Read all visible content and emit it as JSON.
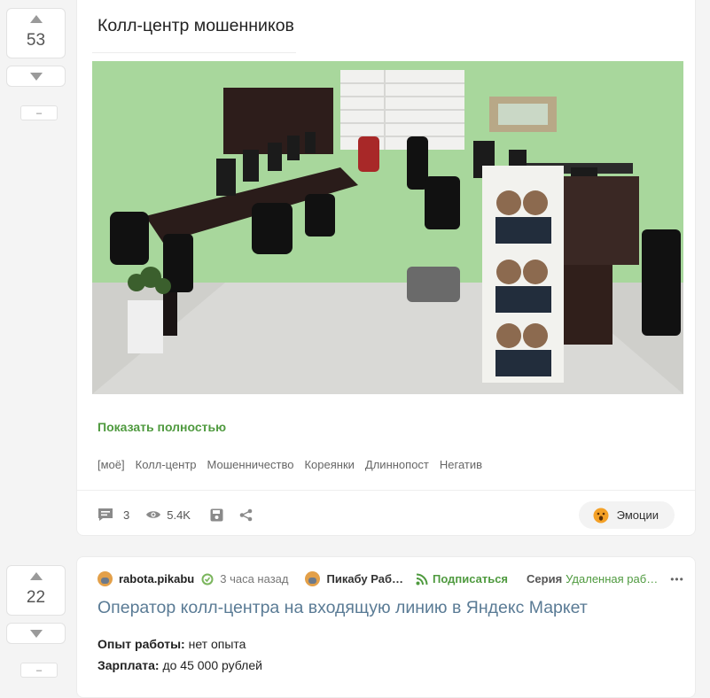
{
  "post1": {
    "score": "53",
    "minus_label": "–",
    "title": "Колл-центр мошенников",
    "show_more": "Показать полностью",
    "tags": [
      "[моё]",
      "Колл-центр",
      "Мошенничество",
      "Кореянки",
      "Длиннопост",
      "Негатив"
    ],
    "comments_count": "3",
    "views_count": "5.4K",
    "emotions_label": "Эмоции"
  },
  "post2": {
    "score": "22",
    "minus_label": "–",
    "author": "rabota.pikabu",
    "time": "3 часа назад",
    "community": "Пикабу Раб…",
    "subscribe": "Подписаться",
    "series_label": "Серия",
    "series_name": "Удаленная раб…",
    "more": "•••",
    "title": "Оператор колл-центра на входящую линию в Яндекс Маркет",
    "experience_label": "Опыт работы:",
    "experience_value": " нет опыта",
    "salary_label": "Зарплата:",
    "salary_value": " до 45 000 рублей"
  },
  "colors": {
    "accent": "#4f9a3f",
    "link_title": "#5a7b95",
    "background": "#f4f4f4"
  }
}
